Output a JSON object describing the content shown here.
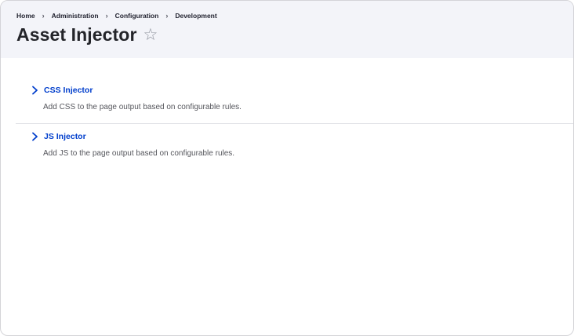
{
  "breadcrumb": {
    "items": [
      "Home",
      "Administration",
      "Configuration",
      "Development"
    ],
    "separator": "›"
  },
  "page": {
    "title": "Asset Injector",
    "favorite_icon": "star-outline-icon"
  },
  "list": {
    "items": [
      {
        "title": "CSS Injector",
        "description": "Add CSS to the page output based on configurable rules.",
        "icon": "chevron-right-icon"
      },
      {
        "title": "JS Injector",
        "description": "Add JS to the page output based on configurable rules.",
        "icon": "chevron-right-icon"
      }
    ]
  },
  "colors": {
    "header_bg": "#f3f4f9",
    "link": "#003ecc",
    "title": "#232429",
    "description": "#55565c",
    "divider": "#dedfe4"
  }
}
